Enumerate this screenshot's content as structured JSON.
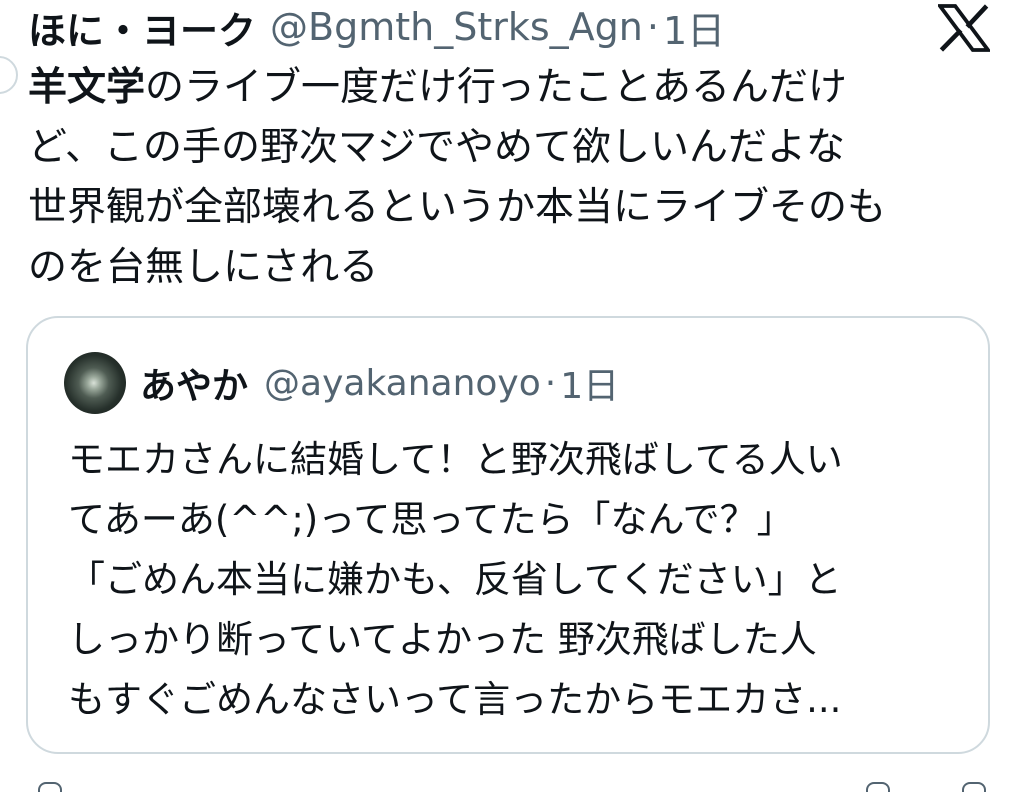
{
  "author": {
    "display_name": "ほに・ヨーク",
    "handle": "@Bgmth_Strks_Agn",
    "separator": "·",
    "time": "1日"
  },
  "tweet": {
    "text_emph": "羊文学",
    "text_rest": "のライブ一度だけ行ったことあるんだけ\nど、この手の野次マジでやめて欲しいんだよな\n世界観が全部壊れるというか本当にライブそのも\nのを台無しにされる"
  },
  "quoted_tweet": {
    "display_name": "あやか",
    "handle": "@ayakananoyo",
    "separator": "·",
    "time": "1日",
    "text": "モエカさんに結婚して！と野次飛ばしてる人い\nてあーあ(^^;)って思ってたら「なんで？」\n「ごめん本当に嫌かも、反省してください」と\nしっかり断っていてよかった 野次飛ばした人\nもすぐごめんなさいって言ったからモエカさ..."
  },
  "icons": {
    "logo": "x-logo-icon",
    "quoted_avatar": "avatar",
    "author_avatar": "avatar"
  },
  "colors": {
    "text": "#0f1419",
    "secondary": "#536471",
    "border": "#cfd9de",
    "background": "#ffffff"
  }
}
